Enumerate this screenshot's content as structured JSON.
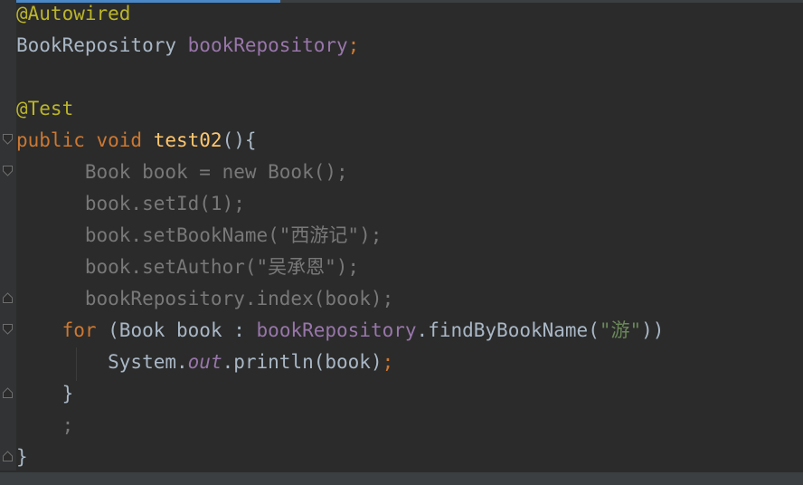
{
  "editor": {
    "lines": [
      {
        "tokens": [
          {
            "text": "@Autowired",
            "role": "annotation"
          }
        ]
      },
      {
        "tokens": [
          {
            "text": "BookRepository ",
            "role": "plain"
          },
          {
            "text": "bookRepository",
            "role": "field"
          },
          {
            "text": ";",
            "role": "semi"
          }
        ]
      },
      {
        "tokens": []
      },
      {
        "tokens": [
          {
            "text": "@Test",
            "role": "annotation"
          }
        ]
      },
      {
        "tokens": [
          {
            "text": "public void ",
            "role": "kw"
          },
          {
            "text": "test02",
            "role": "method-decl"
          },
          {
            "text": "(){",
            "role": "plain"
          }
        ]
      },
      {
        "tokens": [
          {
            "text": "      Book book = new Book();",
            "role": "dim"
          }
        ]
      },
      {
        "tokens": [
          {
            "text": "      book.setId(1);",
            "role": "dim"
          }
        ]
      },
      {
        "tokens": [
          {
            "text": "      book.setBookName(\"西游记\");",
            "role": "dim"
          }
        ]
      },
      {
        "tokens": [
          {
            "text": "      book.setAuthor(\"吴承恩\");",
            "role": "dim"
          }
        ]
      },
      {
        "tokens": [
          {
            "text": "      bookRepository.index(book);",
            "role": "dim"
          }
        ]
      },
      {
        "tokens": [
          {
            "text": "    ",
            "role": "plain"
          },
          {
            "text": "for ",
            "role": "kw"
          },
          {
            "text": "(Book book : ",
            "role": "plain"
          },
          {
            "text": "bookRepository",
            "role": "field"
          },
          {
            "text": ".findByBookName(",
            "role": "plain"
          },
          {
            "text": "\"游\"",
            "role": "str"
          },
          {
            "text": "))",
            "role": "plain"
          }
        ]
      },
      {
        "tokens": [
          {
            "text": "        System.",
            "role": "plain"
          },
          {
            "text": "out",
            "role": "field-italic"
          },
          {
            "text": ".println(book)",
            "role": "plain"
          },
          {
            "text": ";",
            "role": "semi"
          }
        ]
      },
      {
        "tokens": [
          {
            "text": "    }",
            "role": "plain"
          }
        ]
      },
      {
        "tokens": [
          {
            "text": "    ;",
            "role": "dim"
          }
        ]
      },
      {
        "tokens": [
          {
            "text": "}",
            "role": "plain"
          }
        ]
      }
    ]
  },
  "colors": {
    "background": "#2b2b2b",
    "annotation": "#bbb529",
    "keyword": "#cc7832",
    "field": "#9876aa",
    "method": "#ffc66d",
    "string": "#6a8759",
    "text": "#a9b7c6",
    "dimmed": "#787878"
  }
}
